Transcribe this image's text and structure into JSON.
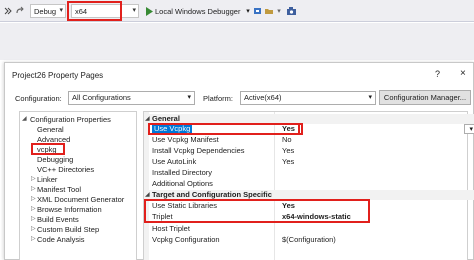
{
  "toolbar": {
    "configuration": "Debug",
    "platform": "x64",
    "debugger_label": "Local Windows Debugger",
    "accent": "#e1201c"
  },
  "dialog": {
    "title": "Project26 Property Pages",
    "help": "?",
    "close": "×",
    "configuration_label": "Configuration:",
    "configuration_value": "All Configurations",
    "platform_label": "Platform:",
    "platform_value": "Active(x64)",
    "config_manager_label": "Configuration Manager..."
  },
  "tree": {
    "root": "Configuration Properties",
    "items": [
      "General",
      "Advanced",
      "vcpkg",
      "Debugging",
      "VC++ Directories",
      "Linker",
      "Manifest Tool",
      "XML Document Generator",
      "Browse Information",
      "Build Events",
      "Custom Build Step",
      "Code Analysis"
    ]
  },
  "grid": {
    "sections": [
      "General",
      "Target and Configuration Specific"
    ],
    "general": [
      {
        "name": "Use Vcpkg",
        "value": "Yes"
      },
      {
        "name": "Use Vcpkg Manifest",
        "value": "No"
      },
      {
        "name": "Install Vcpkg Dependencies",
        "value": "Yes"
      },
      {
        "name": "Use AutoLink",
        "value": "Yes"
      },
      {
        "name": "Installed Directory",
        "value": ""
      },
      {
        "name": "Additional Options",
        "value": ""
      }
    ],
    "target": [
      {
        "name": "Use Static Libraries",
        "value": "Yes"
      },
      {
        "name": "Triplet",
        "value": "x64-windows-static"
      },
      {
        "name": "Host Triplet",
        "value": ""
      },
      {
        "name": "Vcpkg Configuration",
        "value": "$(Configuration)"
      }
    ]
  }
}
